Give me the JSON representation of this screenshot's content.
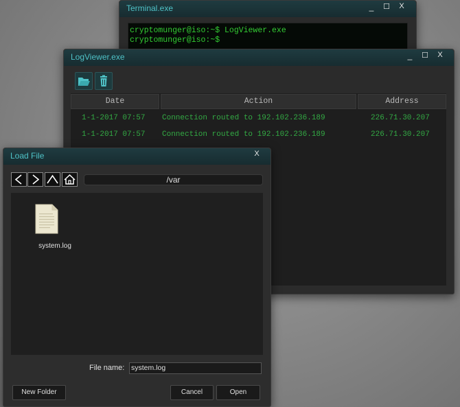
{
  "terminal": {
    "title": "Terminal.exe",
    "lines": [
      "cryptomunger@iso:~$ LogViewer.exe",
      "cryptomunger@iso:~$"
    ],
    "controls": {
      "minimize": "_",
      "maximize": "☐",
      "close": "X"
    }
  },
  "logviewer": {
    "title": "LogViewer.exe",
    "toolbar": {
      "open_icon": "folder-open-icon",
      "delete_icon": "trash-icon"
    },
    "columns": [
      "Date",
      "Action",
      "Address"
    ],
    "rows": [
      {
        "date": "1-1-2017 07:57",
        "action": "Connection routed to 192.102.236.189",
        "address": "226.71.30.207"
      },
      {
        "date": "1-1-2017 07:57",
        "action": "Connection routed to 192.102.236.189",
        "address": "226.71.30.207"
      }
    ],
    "controls": {
      "minimize": "_",
      "maximize": "☐",
      "close": "X"
    }
  },
  "loadfile": {
    "title": "Load File",
    "close": "X",
    "nav": {
      "back_icon": "arrow-left-icon",
      "forward_icon": "arrow-right-icon",
      "up_icon": "arrow-up-icon",
      "home_icon": "home-icon"
    },
    "path": "/var",
    "files": [
      {
        "name": "system.log",
        "icon": "document-icon"
      }
    ],
    "file_name_label": "File name:",
    "file_name_value": "system.log",
    "buttons": {
      "new_folder": "New Folder",
      "cancel": "Cancel",
      "open": "Open"
    }
  },
  "colors": {
    "accent": "#4fc3c8",
    "terminal_text": "#33cc33",
    "log_text": "#33aa44",
    "titlebar": "#1f3b40"
  }
}
